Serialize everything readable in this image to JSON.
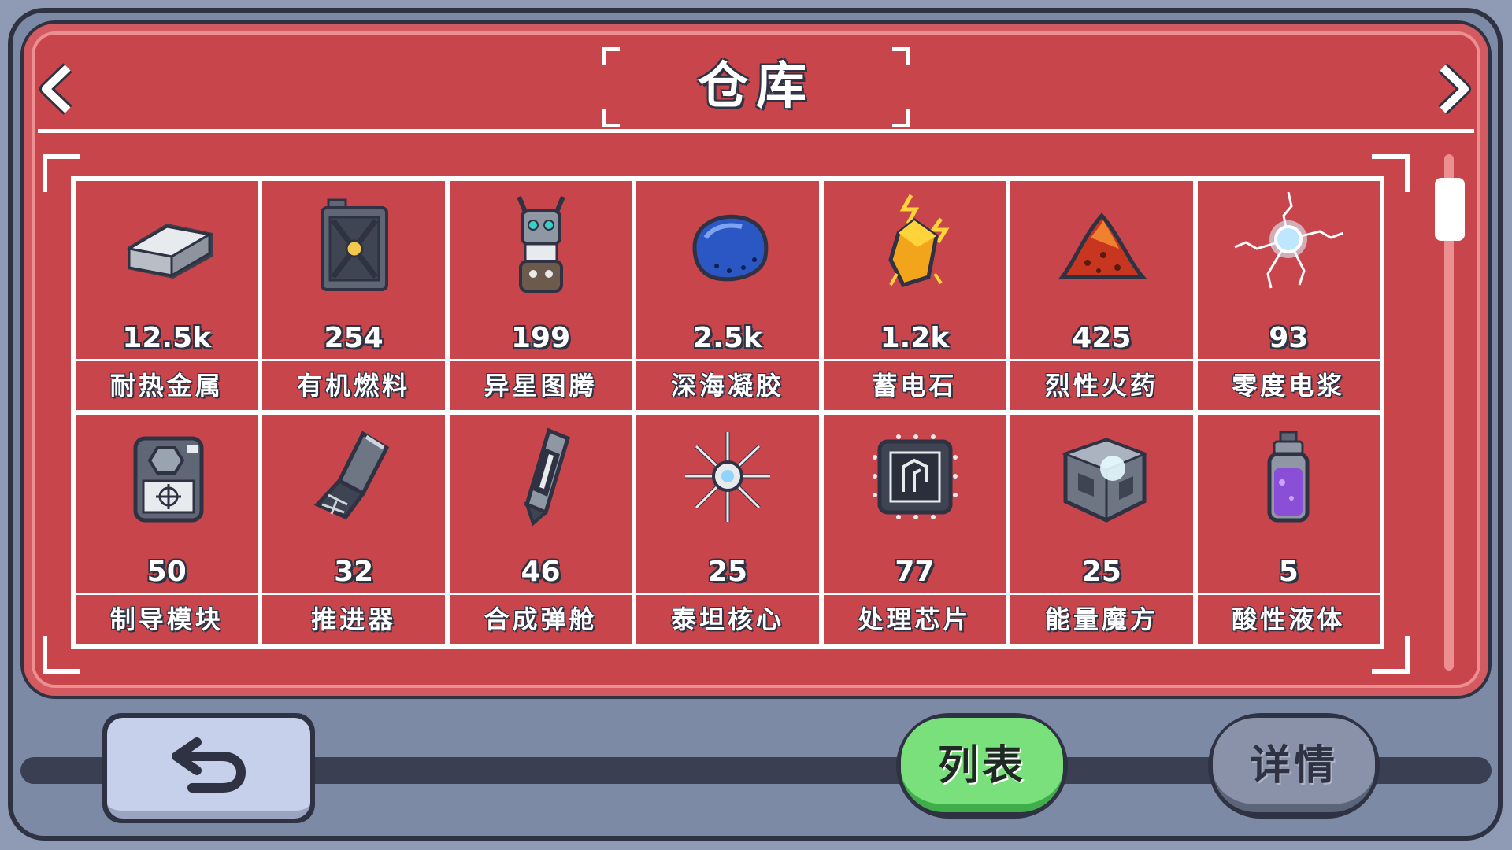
{
  "header": {
    "title": "仓库"
  },
  "items": [
    {
      "qty": "12.5k",
      "name": "耐热金属",
      "icon": "heat-resistant-metal-icon"
    },
    {
      "qty": "254",
      "name": "有机燃料",
      "icon": "organic-fuel-icon"
    },
    {
      "qty": "199",
      "name": "异星图腾",
      "icon": "alien-totem-icon"
    },
    {
      "qty": "2.5k",
      "name": "深海凝胶",
      "icon": "deep-sea-gel-icon"
    },
    {
      "qty": "1.2k",
      "name": "蓄电石",
      "icon": "battery-stone-icon"
    },
    {
      "qty": "425",
      "name": "烈性火药",
      "icon": "gunpowder-icon"
    },
    {
      "qty": "93",
      "name": "零度电浆",
      "icon": "zero-plasma-icon"
    },
    {
      "qty": "50",
      "name": "制导模块",
      "icon": "guidance-module-icon"
    },
    {
      "qty": "32",
      "name": "推进器",
      "icon": "thruster-icon"
    },
    {
      "qty": "46",
      "name": "合成弹舱",
      "icon": "ammo-capsule-icon"
    },
    {
      "qty": "25",
      "name": "泰坦核心",
      "icon": "titan-core-icon"
    },
    {
      "qty": "77",
      "name": "处理芯片",
      "icon": "processing-chip-icon"
    },
    {
      "qty": "25",
      "name": "能量魔方",
      "icon": "energy-cube-icon"
    },
    {
      "qty": "5",
      "name": "酸性液体",
      "icon": "acid-liquid-icon"
    }
  ],
  "buttons": {
    "list": "列表",
    "detail": "详情"
  },
  "colors": {
    "panel": "#c9454c",
    "frame": "#7d8aa6",
    "outline": "#2e3242",
    "list_button": "#79e07c",
    "detail_button": "#8992a8"
  }
}
